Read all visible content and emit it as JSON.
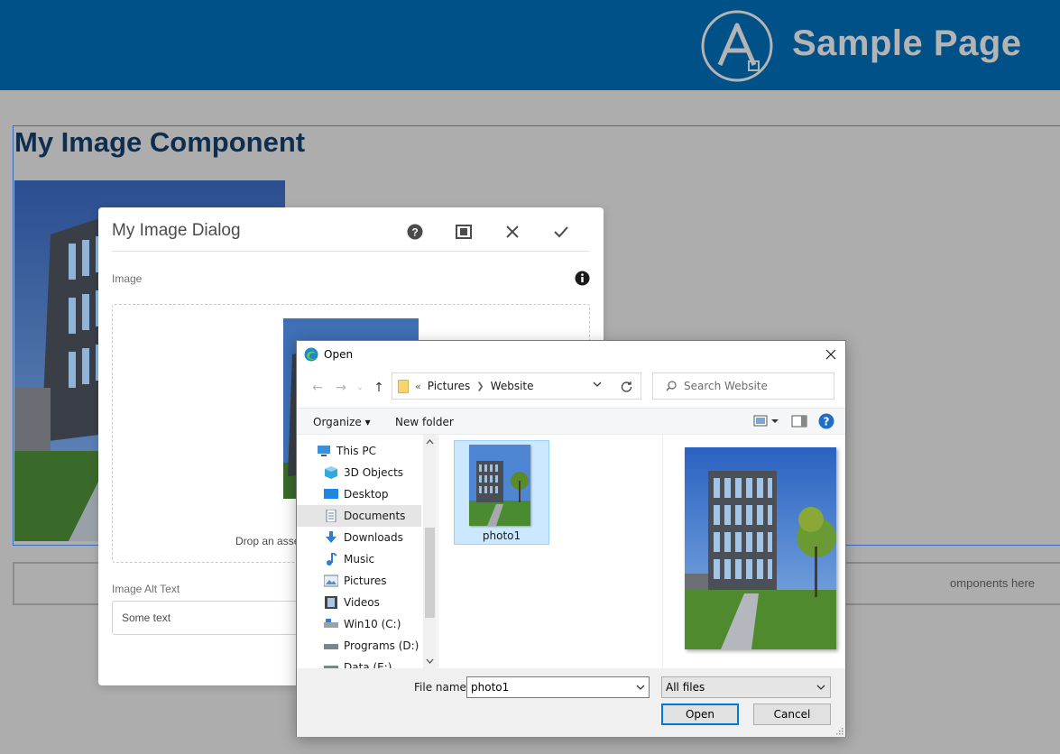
{
  "header": {
    "site_title": "Sample Page",
    "logo_icon": "adobe-experience-logo"
  },
  "page": {
    "component_title": "My Image Component",
    "parsys_placeholder": "omponents here"
  },
  "aem_dialog": {
    "title": "My Image Dialog",
    "tools": [
      "help-icon",
      "fullscreen-icon",
      "close-icon",
      "done-icon"
    ],
    "image_label": "Image",
    "drop_text": "Drop an asse",
    "alt_label": "Image Alt Text",
    "alt_value": "Some text"
  },
  "open_dialog": {
    "title": "Open",
    "breadcrumb_prefix": "«",
    "breadcrumbs": [
      "Pictures",
      "Website"
    ],
    "search_placeholder": "Search Website",
    "toolbar": {
      "organize": "Organize ▾",
      "new_folder": "New folder"
    },
    "nav_items": [
      {
        "label": "This PC",
        "icon": "pc-icon"
      },
      {
        "label": "3D Objects",
        "icon": "cube-icon"
      },
      {
        "label": "Desktop",
        "icon": "desktop-icon"
      },
      {
        "label": "Documents",
        "icon": "document-icon",
        "selected": true
      },
      {
        "label": "Downloads",
        "icon": "download-icon"
      },
      {
        "label": "Music",
        "icon": "music-icon"
      },
      {
        "label": "Pictures",
        "icon": "pictures-icon"
      },
      {
        "label": "Videos",
        "icon": "video-icon"
      },
      {
        "label": "Win10 (C:)",
        "icon": "drive-icon"
      },
      {
        "label": "Programs (D:)",
        "icon": "drive-icon"
      },
      {
        "label": "Data (E:)",
        "icon": "drive-icon"
      }
    ],
    "files": [
      {
        "name": "photo1",
        "selected": true
      }
    ],
    "file_name_label": "File name:",
    "file_name_value": "photo1",
    "file_type": "All files",
    "open_button": "Open",
    "cancel_button": "Cancel"
  },
  "colors": {
    "header_bg": "#005187",
    "page_bg": "#adadad",
    "accent": "#0078d7"
  }
}
